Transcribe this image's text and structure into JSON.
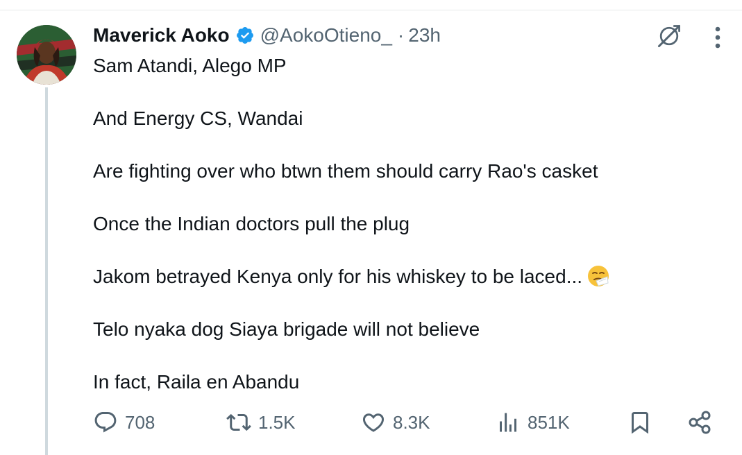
{
  "tweet": {
    "author_name": "Maverick Aoko",
    "handle": "@AokoOtieno_",
    "separator": "·",
    "time": "23h",
    "lines": [
      "Sam Atandi, Alego MP",
      "And Energy CS, Wandai",
      "Are fighting over who btwn them should carry Rao's casket",
      "Once the Indian doctors pull the plug",
      "Jakom betrayed Kenya only for his whiskey to be laced...",
      "Telo nyaka dog Siaya brigade will not believe",
      "In fact, Raila en Abandu"
    ],
    "emoji_icon": "sneezing-face-emoji"
  },
  "actions": {
    "replies": "708",
    "retweets": "1.5K",
    "likes": "8.3K",
    "views": "851K"
  },
  "colors": {
    "text": "#0f1419",
    "secondary": "#536471",
    "verified": "#1d9bf0",
    "thread_line": "#cfd9de"
  }
}
